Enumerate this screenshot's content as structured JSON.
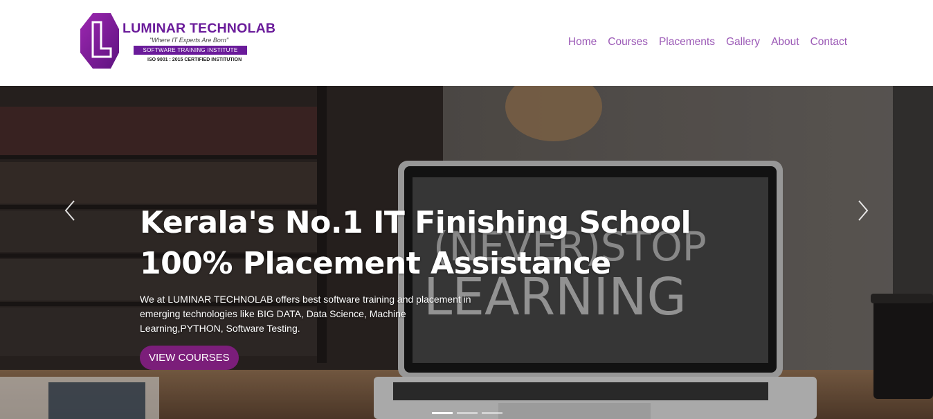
{
  "brand": {
    "name": "LUMINAR TECHNOLAB",
    "tagline": "\"Where IT Experts Are Born\"",
    "subtitle": "SOFTWARE TRAINING INSTITUTE",
    "certification": "ISO 9001 : 2015 CERTIFIED INSTITUTION",
    "color": "#6a1b9a"
  },
  "nav": {
    "items": [
      {
        "label": "Home"
      },
      {
        "label": "Courses"
      },
      {
        "label": "Placements"
      },
      {
        "label": "Gallery"
      },
      {
        "label": "About"
      },
      {
        "label": "Contact"
      }
    ],
    "color": "#9b59b6"
  },
  "hero": {
    "heading_line1": "Kerala's No.1 IT Finishing School",
    "heading_line2": "100% Placement Assistance",
    "description": "We at LUMINAR TECHNOLAB offers best software training and placement in emerging technologies like BIG DATA, Data Science, Machine Learning,PYTHON, Software Testing.",
    "cta_label": "VIEW COURSES",
    "cta_color": "#7b1e7a",
    "screen_text_line1": "(NEVER)STOP",
    "screen_text_line2": "LEARNING",
    "prev_icon": "chevron-left-icon",
    "next_icon": "chevron-right-icon",
    "slides": [
      {
        "active": true
      },
      {
        "active": false
      },
      {
        "active": false
      }
    ]
  }
}
